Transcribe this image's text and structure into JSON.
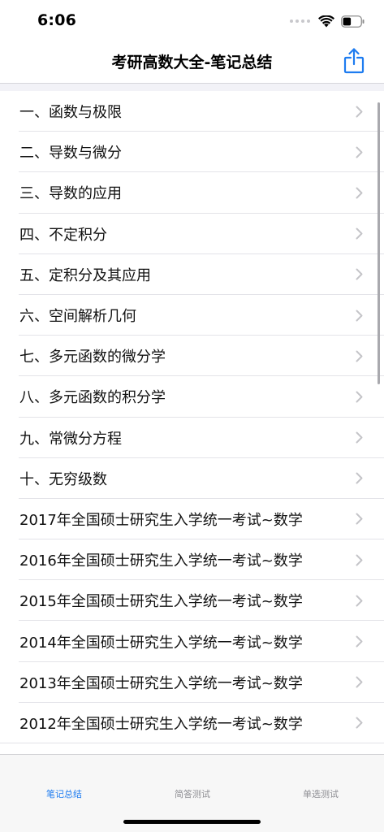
{
  "status_bar": {
    "time": "6:06"
  },
  "nav": {
    "title": "考研高数大全-笔记总结",
    "share_icon": "share-icon",
    "accent_color": "#1e7cf0"
  },
  "list": {
    "items": [
      {
        "label": "一、函数与极限"
      },
      {
        "label": "二、导数与微分"
      },
      {
        "label": "三、导数的应用"
      },
      {
        "label": "四、不定积分"
      },
      {
        "label": "五、定积分及其应用"
      },
      {
        "label": "六、空间解析几何"
      },
      {
        "label": "七、多元函数的微分学"
      },
      {
        "label": "八、多元函数的积分学"
      },
      {
        "label": "九、常微分方程"
      },
      {
        "label": "十、无穷级数"
      },
      {
        "label": "2017年全国硕士研究生入学统一考试~数学"
      },
      {
        "label": "2016年全国硕士研究生入学统一考试~数学"
      },
      {
        "label": "2015年全国硕士研究生入学统一考试~数学"
      },
      {
        "label": "2014年全国硕士研究生入学统一考试~数学"
      },
      {
        "label": "2013年全国硕士研究生入学统一考试~数学"
      },
      {
        "label": "2012年全国硕士研究生入学统一考试~数学"
      }
    ]
  },
  "tab_bar": {
    "tabs": [
      {
        "label": "笔记总结",
        "active": true
      },
      {
        "label": "简答测试",
        "active": false
      },
      {
        "label": "单选测试",
        "active": false
      }
    ]
  }
}
